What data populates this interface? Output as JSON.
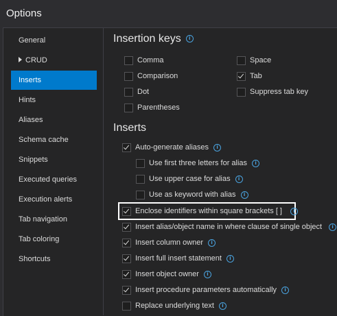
{
  "window": {
    "title": "Options"
  },
  "sidebar": {
    "items": [
      {
        "label": "General"
      },
      {
        "label": "CRUD"
      },
      {
        "label": "Inserts"
      },
      {
        "label": "Hints"
      },
      {
        "label": "Aliases"
      },
      {
        "label": "Schema cache"
      },
      {
        "label": "Snippets"
      },
      {
        "label": "Executed queries"
      },
      {
        "label": "Execution alerts"
      },
      {
        "label": "Tab navigation"
      },
      {
        "label": "Tab coloring"
      },
      {
        "label": "Shortcuts"
      }
    ],
    "active": "Inserts"
  },
  "insertion_keys": {
    "heading": "Insertion keys",
    "options": [
      {
        "label": "Comma",
        "checked": false
      },
      {
        "label": "Comparison",
        "checked": false
      },
      {
        "label": "Dot",
        "checked": false
      },
      {
        "label": "Parentheses",
        "checked": false
      },
      {
        "label": "Space",
        "checked": false
      },
      {
        "label": "Tab",
        "checked": true
      },
      {
        "label": "Suppress tab key",
        "checked": false
      }
    ]
  },
  "inserts": {
    "heading": "Inserts",
    "options": [
      {
        "label": "Auto-generate aliases",
        "checked": true
      },
      {
        "label": "Use first three letters for alias",
        "checked": false
      },
      {
        "label": "Use upper case for alias",
        "checked": false
      },
      {
        "label": "Use as keyword with alias",
        "checked": false
      },
      {
        "label": "Enclose identifiers within square brackets [ ]",
        "checked": true
      },
      {
        "label": "Insert alias/object name in where clause of single object",
        "checked": true
      },
      {
        "label": "Insert column owner",
        "checked": true
      },
      {
        "label": "Insert full insert statement",
        "checked": true
      },
      {
        "label": "Insert object owner",
        "checked": true
      },
      {
        "label": "Insert procedure parameters automatically",
        "checked": true
      },
      {
        "label": "Replace underlying text",
        "checked": false
      }
    ]
  },
  "colors": {
    "accent": "#007acc",
    "background": "#252526",
    "info": "#4aa3df"
  },
  "icons": {
    "info": "info-circle-icon",
    "expand": "triangle-right-icon",
    "check": "checkmark-icon"
  }
}
